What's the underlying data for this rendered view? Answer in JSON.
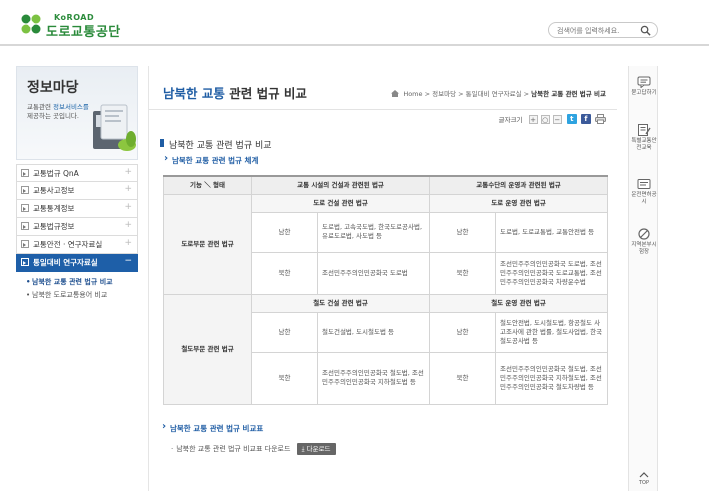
{
  "header": {
    "logo_en": "KoROAD",
    "logo_ko": "도로교통공단",
    "search_placeholder": "검색어를 입력하세요."
  },
  "sidebar": {
    "banner_title": "정보마당",
    "banner_desc_1": "교통관련",
    "banner_desc_highlight": "정보서비스를",
    "banner_desc_2": "제공하는 곳입니다.",
    "items": [
      {
        "label": "교통법규 QnA"
      },
      {
        "label": "교통사고정보"
      },
      {
        "label": "교통통계정보"
      },
      {
        "label": "교통법규정보"
      },
      {
        "label": "교통안전 · 연구자료실"
      },
      {
        "label": "통일대비 연구자료실"
      }
    ],
    "active_sign": "−",
    "inactive_sign": "+",
    "sub_items": [
      {
        "label": "남북한 교통 관련 법규 비교"
      },
      {
        "label": "남북한 도로교통용어 비교"
      }
    ]
  },
  "main": {
    "title_hl": "남북한 교통",
    "title_rest": " 관련 법규 비교",
    "breadcrumb": {
      "home": "Home",
      "sep": ">",
      "c1": "정보마당",
      "c2": "통일대비 연구자료실",
      "last": "남북한 교통 관련 법규 비교"
    },
    "font_size_label": "글자크기",
    "font_plus": "+",
    "font_reset": "○",
    "font_minus": "−",
    "section_title": "남북한 교통 관련 법규 비교",
    "section_sub": "남북한 교통 관련 법규 체계",
    "table": {
      "head_col0": "기능 ＼ 형태",
      "head_col1": "교통 시설의 건설과 관련된 법규",
      "head_col2": "교통수단의 운영과 관련된 법규",
      "road": {
        "label": "도로부문 관련 법규",
        "sub1": "도로 건설 관련 법규",
        "sub2": "도로 운영 관련 법규",
        "south": "남한",
        "north": "북한",
        "south_build": "도로법, 고속국도법, 한국도로공사법, 유료도로법, 사도법 등",
        "south_oper": "도로법, 도로교통법, 교통안전법 등",
        "north_build": "조선민주주의인민공화국 도로법",
        "north_oper": "조선민주주의인민공화국 도로법, 조선민주주의인민공화국 도로교통법, 조선민주주의인민공화국 차량운수법"
      },
      "rail": {
        "label": "철도부문 관련 법규",
        "sub1": "철도 건설 관련 법규",
        "sub2": "철도 운영 관련 법규",
        "south": "남한",
        "north": "북한",
        "south_build": "철도건설법, 도시철도법 등",
        "south_oper": "철도안전법, 도시철도법, 항공철도 사고조사에 관한 법률, 철도사업법, 한국철도공사법 등",
        "north_build": "조선민주주의인민공화국 철도법, 조선민주주의인민공화국 지하철도법 등",
        "north_oper": "조선민주주의인민공화국 철도법, 조선민주주의인민공화국 지하철도법, 조선민주주의인민공화국 철도차량법 등"
      }
    },
    "download_title": "남북한 교통 관련 법규 비교표",
    "download_text": "남북한 교통 관련 법규 비교표 다운로드",
    "download_btn": "다운로드"
  },
  "quick": {
    "q1": "묻고답하기",
    "q2": "특별교통안전교육",
    "q3": "운전면허공시",
    "q4": "지역본부시험장",
    "top": "TOP"
  },
  "colors": {
    "brand_green": "#2a8a3a",
    "accent_blue": "#1f5da4",
    "nav_active": "#1e5fa8"
  }
}
